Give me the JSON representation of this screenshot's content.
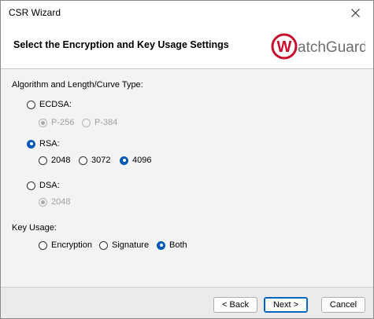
{
  "window": {
    "title": "CSR Wizard"
  },
  "header": {
    "title": "Select the Encryption and Key Usage Settings",
    "logo_text": "WatchGuard"
  },
  "algorithm": {
    "label": "Algorithm and Length/Curve Type:",
    "ecdsa": {
      "label": "ECDSA:",
      "options": [
        "P-256",
        "P-384"
      ]
    },
    "rsa": {
      "label": "RSA:",
      "options": [
        "2048",
        "3072",
        "4096"
      ],
      "selected": "4096"
    },
    "dsa": {
      "label": "DSA:",
      "options": [
        "2048"
      ]
    },
    "selected": "RSA:"
  },
  "key_usage": {
    "label": "Key Usage:",
    "options": [
      "Encryption",
      "Signature",
      "Both"
    ],
    "selected": "Both"
  },
  "buttons": {
    "back": "< Back",
    "next": "Next >",
    "cancel": "Cancel"
  },
  "colors": {
    "accent": "#0059b3",
    "logo_red": "#c8102e",
    "logo_grey": "#6d6e71"
  }
}
